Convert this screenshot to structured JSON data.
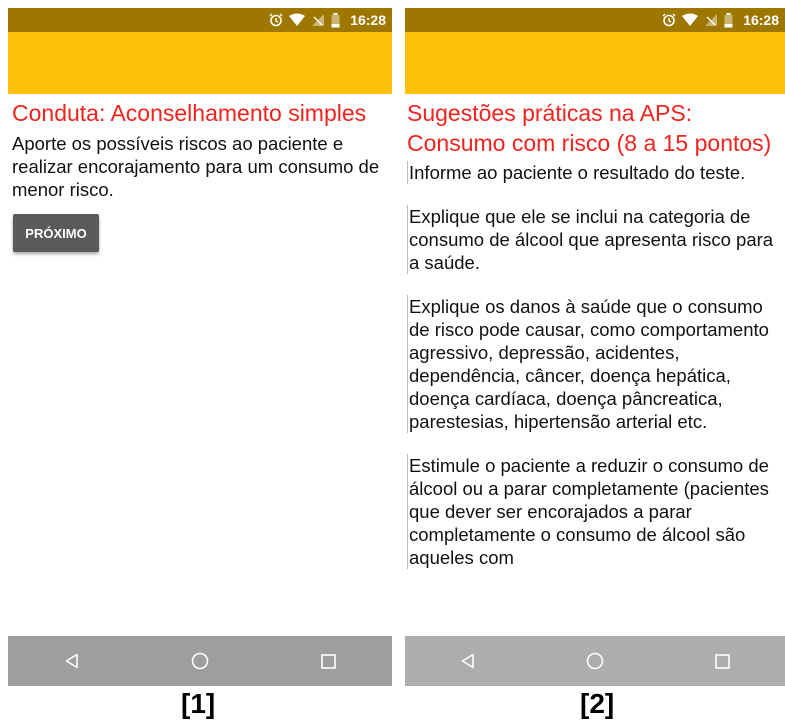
{
  "status_bar": {
    "time": "16:28",
    "icons": [
      "alarm-icon",
      "wifi-icon",
      "no-signal-icon",
      "battery-icon"
    ]
  },
  "colors": {
    "status_bar": "#9e7700",
    "app_bar": "#ffc107",
    "title": "#f2231d",
    "button": "#5a5a5a",
    "nav_bar": "#9e9e9e"
  },
  "screen1": {
    "title": "Conduta: Aconselhamento simples",
    "body": "Aporte os possíveis riscos ao paciente e realizar encorajamento para um consumo de menor risco.",
    "next_button": "PRÓXIMO",
    "caption": "[1]"
  },
  "screen2": {
    "title": "Sugestões práticas na APS: Consumo com risco (8 a 15 pontos)",
    "paragraphs": [
      "Informe ao paciente o resultado do teste.",
      "Explique que ele se inclui na categoria de consumo de álcool que apresenta risco para a saúde.",
      "Explique os danos à saúde que o consumo de risco pode causar, como comportamento agressivo, depressão, acidentes, dependência, câncer, doença hepática, doença cardíaca, doença pâncreatica, parestesias, hipertensão arterial etc.",
      "Estimule o paciente a reduzir o consumo de álcool ou a parar completamente (pacientes que dever ser encorajados a parar completamente o consumo de álcool são aqueles com"
    ],
    "caption": "[2]"
  },
  "nav_bar": {
    "icons": [
      "back-icon",
      "home-icon",
      "recents-icon"
    ]
  }
}
